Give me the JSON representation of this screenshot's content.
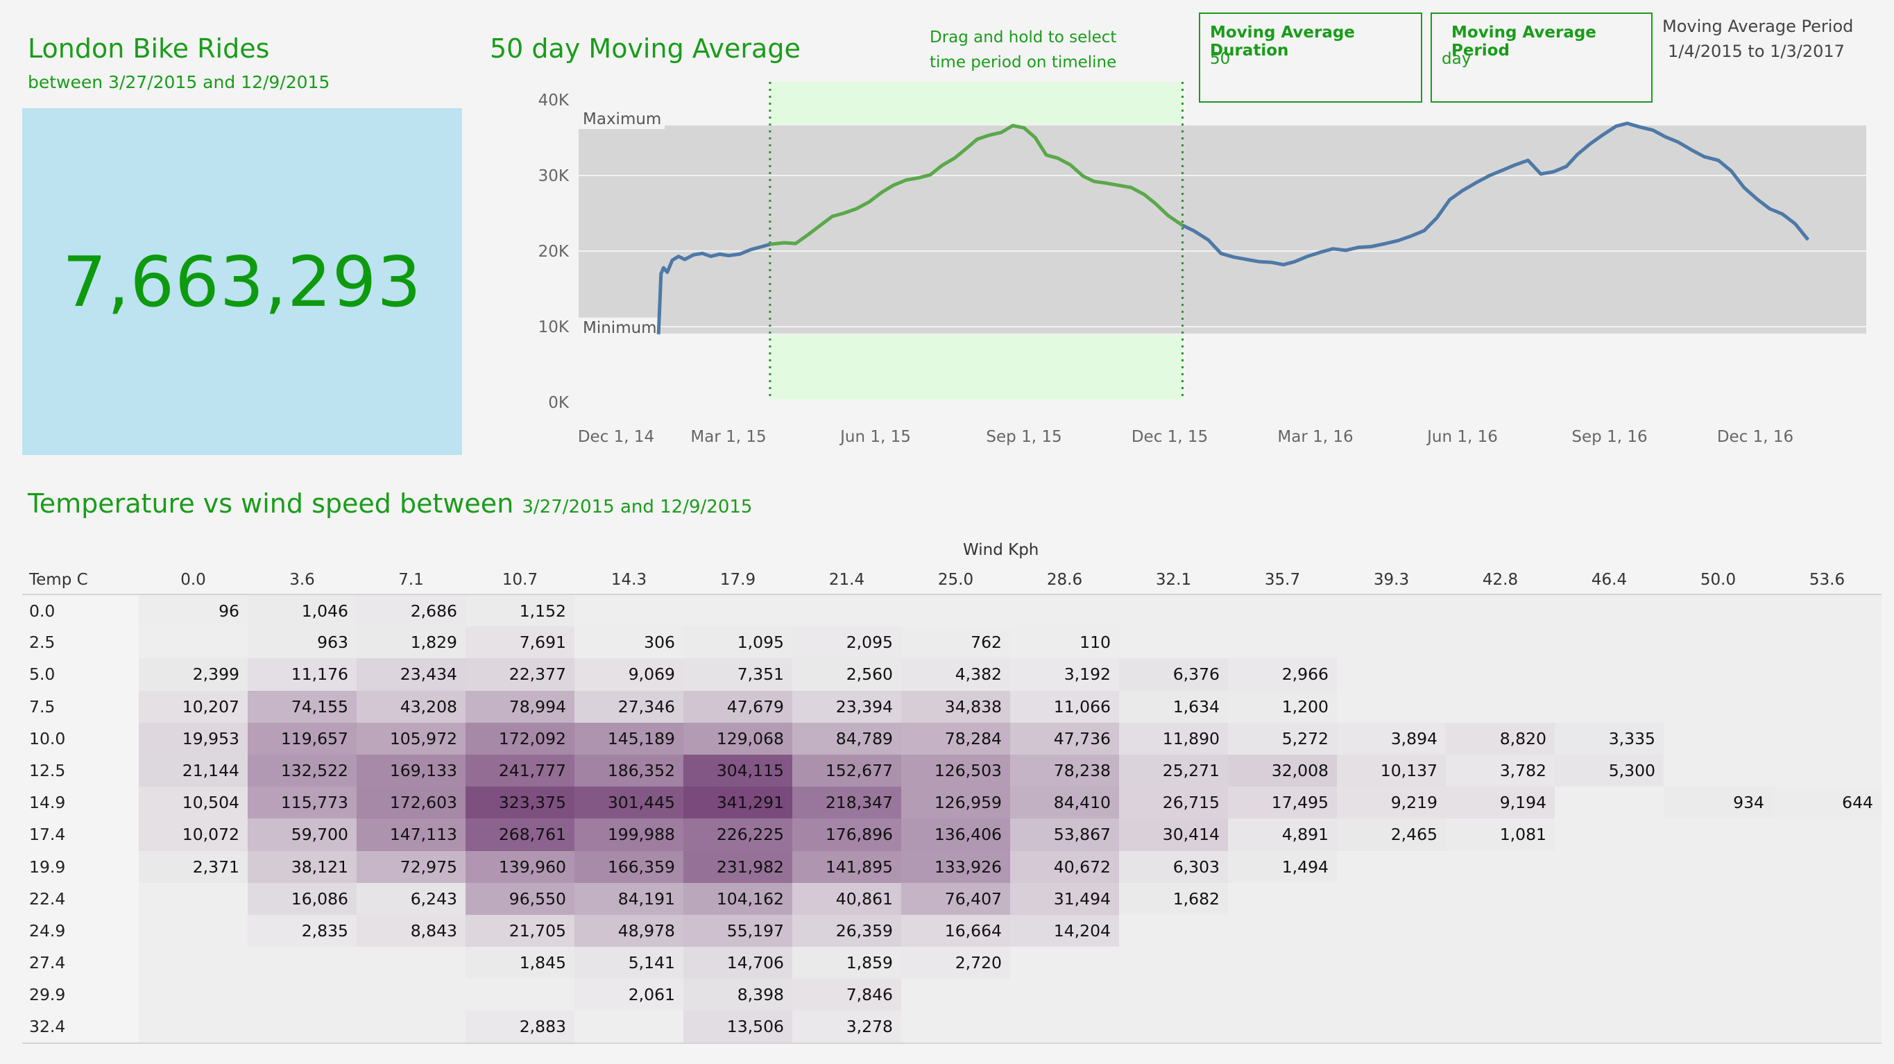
{
  "header": {
    "title": "London Bike Rides",
    "subtitle": "between 3/27/2015 and 12/9/2015",
    "total_rides": "7,663,293"
  },
  "moving_average": {
    "title": "50 day Moving Average",
    "drag_hint": "Drag and hold to select time period on timeline",
    "duration_label": "Moving Average Duration",
    "duration_value": "50",
    "period_label": "Moving Average Period",
    "period_value": "day",
    "info_label": "Moving Average Period",
    "info_value": "1/4/2015 to 1/3/2017"
  },
  "chart_data": {
    "type": "line",
    "title": "50 day Moving Average",
    "xlabel": "",
    "ylabel": "",
    "x_ticks": [
      "Dec 1, 14",
      "Mar 1, 15",
      "Jun 1, 15",
      "Sep 1, 15",
      "Dec 1, 15",
      "Mar 1, 16",
      "Jun 1, 16",
      "Sep 1, 16",
      "Dec 1, 16"
    ],
    "y_ticks": [
      "0K",
      "10K",
      "20K",
      "30K",
      "40K"
    ],
    "ylim": [
      0,
      40000
    ],
    "reference_band": {
      "min_label": "Minimum",
      "max_label": "Maximum",
      "min": 9000,
      "max": 36700
    },
    "highlight_range": [
      "2015-03-27",
      "2015-12-09"
    ],
    "series": [
      {
        "points": [
          [
            "2015-01-04",
            9000
          ],
          [
            "2015-01-06",
            17000
          ],
          [
            "2015-01-08",
            17800
          ],
          [
            "2015-01-11",
            17200
          ],
          [
            "2015-01-15",
            18800
          ],
          [
            "2015-01-20",
            19300
          ],
          [
            "2015-01-25",
            18900
          ],
          [
            "2015-02-01",
            19500
          ],
          [
            "2015-02-08",
            19700
          ],
          [
            "2015-02-15",
            19300
          ],
          [
            "2015-02-22",
            19600
          ],
          [
            "2015-03-01",
            19400
          ],
          [
            "2015-03-08",
            19600
          ],
          [
            "2015-03-15",
            20200
          ],
          [
            "2015-03-22",
            20600
          ],
          [
            "2015-03-27",
            20900
          ],
          [
            "2015-04-05",
            21100
          ],
          [
            "2015-04-12",
            21000
          ],
          [
            "2015-04-20",
            22200
          ],
          [
            "2015-04-28",
            23500
          ],
          [
            "2015-05-05",
            24600
          ],
          [
            "2015-05-12",
            25000
          ],
          [
            "2015-05-20",
            25600
          ],
          [
            "2015-05-28",
            26500
          ],
          [
            "2015-06-05",
            27800
          ],
          [
            "2015-06-12",
            28700
          ],
          [
            "2015-06-20",
            29400
          ],
          [
            "2015-06-28",
            29700
          ],
          [
            "2015-07-05",
            30100
          ],
          [
            "2015-07-12",
            31300
          ],
          [
            "2015-07-20",
            32300
          ],
          [
            "2015-07-28",
            33700
          ],
          [
            "2015-08-03",
            34800
          ],
          [
            "2015-08-10",
            35300
          ],
          [
            "2015-08-18",
            35700
          ],
          [
            "2015-08-25",
            36600
          ],
          [
            "2015-09-01",
            36300
          ],
          [
            "2015-09-08",
            35000
          ],
          [
            "2015-09-15",
            32700
          ],
          [
            "2015-09-22",
            32300
          ],
          [
            "2015-09-30",
            31400
          ],
          [
            "2015-10-08",
            29900
          ],
          [
            "2015-10-15",
            29200
          ],
          [
            "2015-10-22",
            29000
          ],
          [
            "2015-10-30",
            28700
          ],
          [
            "2015-11-07",
            28400
          ],
          [
            "2015-11-15",
            27500
          ],
          [
            "2015-11-22",
            26300
          ],
          [
            "2015-11-30",
            24700
          ],
          [
            "2015-12-09",
            23400
          ],
          [
            "2015-12-16",
            22700
          ],
          [
            "2015-12-25",
            21500
          ],
          [
            "2016-01-02",
            19700
          ],
          [
            "2016-01-10",
            19200
          ],
          [
            "2016-01-18",
            18900
          ],
          [
            "2016-01-26",
            18600
          ],
          [
            "2016-02-03",
            18500
          ],
          [
            "2016-02-10",
            18200
          ],
          [
            "2016-02-17",
            18600
          ],
          [
            "2016-02-25",
            19300
          ],
          [
            "2016-03-05",
            19900
          ],
          [
            "2016-03-12",
            20300
          ],
          [
            "2016-03-20",
            20100
          ],
          [
            "2016-03-28",
            20500
          ],
          [
            "2016-04-05",
            20600
          ],
          [
            "2016-04-14",
            21000
          ],
          [
            "2016-04-22",
            21400
          ],
          [
            "2016-04-30",
            22000
          ],
          [
            "2016-05-08",
            22700
          ],
          [
            "2016-05-16",
            24400
          ],
          [
            "2016-05-24",
            26800
          ],
          [
            "2016-06-01",
            28000
          ],
          [
            "2016-06-10",
            29100
          ],
          [
            "2016-06-18",
            30000
          ],
          [
            "2016-06-26",
            30700
          ],
          [
            "2016-07-04",
            31400
          ],
          [
            "2016-07-12",
            32000
          ],
          [
            "2016-07-20",
            30200
          ],
          [
            "2016-07-28",
            30500
          ],
          [
            "2016-08-05",
            31200
          ],
          [
            "2016-08-12",
            32800
          ],
          [
            "2016-08-20",
            34200
          ],
          [
            "2016-08-28",
            35400
          ],
          [
            "2016-09-05",
            36500
          ],
          [
            "2016-09-12",
            36900
          ],
          [
            "2016-09-20",
            36400
          ],
          [
            "2016-09-28",
            36000
          ],
          [
            "2016-10-06",
            35100
          ],
          [
            "2016-10-14",
            34400
          ],
          [
            "2016-10-22",
            33400
          ],
          [
            "2016-10-30",
            32500
          ],
          [
            "2016-11-08",
            32000
          ],
          [
            "2016-11-16",
            30600
          ],
          [
            "2016-11-24",
            28400
          ],
          [
            "2016-12-02",
            26900
          ],
          [
            "2016-12-10",
            25600
          ],
          [
            "2016-12-18",
            24900
          ],
          [
            "2016-12-26",
            23600
          ],
          [
            "2017-01-03",
            21500
          ]
        ]
      }
    ]
  },
  "heatmap": {
    "title": "Temperature vs wind speed between",
    "title_range": "3/27/2015 and 12/9/2015",
    "column_axis_label": "Wind Kph",
    "row_axis_label": "Temp C",
    "columns": [
      "0.0",
      "3.6",
      "7.1",
      "10.7",
      "14.3",
      "17.9",
      "21.4",
      "25.0",
      "28.6",
      "32.1",
      "35.7",
      "39.3",
      "42.8",
      "46.4",
      "50.0",
      "53.6"
    ],
    "rows": [
      {
        "label": "0.0",
        "values": [
          "96",
          "1,046",
          "2,686",
          "1,152",
          "",
          "",
          "",
          "",
          "",
          "",
          "",
          "",
          "",
          "",
          "",
          ""
        ]
      },
      {
        "label": "2.5",
        "values": [
          "",
          "963",
          "1,829",
          "7,691",
          "306",
          "1,095",
          "2,095",
          "762",
          "110",
          "",
          "",
          "",
          "",
          "",
          "",
          ""
        ]
      },
      {
        "label": "5.0",
        "values": [
          "2,399",
          "11,176",
          "23,434",
          "22,377",
          "9,069",
          "7,351",
          "2,560",
          "4,382",
          "3,192",
          "6,376",
          "2,966",
          "",
          "",
          "",
          "",
          ""
        ]
      },
      {
        "label": "7.5",
        "values": [
          "10,207",
          "74,155",
          "43,208",
          "78,994",
          "27,346",
          "47,679",
          "23,394",
          "34,838",
          "11,066",
          "1,634",
          "1,200",
          "",
          "",
          "",
          "",
          ""
        ]
      },
      {
        "label": "10.0",
        "values": [
          "19,953",
          "119,657",
          "105,972",
          "172,092",
          "145,189",
          "129,068",
          "84,789",
          "78,284",
          "47,736",
          "11,890",
          "5,272",
          "3,894",
          "8,820",
          "3,335",
          "",
          ""
        ]
      },
      {
        "label": "12.5",
        "values": [
          "21,144",
          "132,522",
          "169,133",
          "241,777",
          "186,352",
          "304,115",
          "152,677",
          "126,503",
          "78,238",
          "25,271",
          "32,008",
          "10,137",
          "3,782",
          "5,300",
          "",
          ""
        ]
      },
      {
        "label": "14.9",
        "values": [
          "10,504",
          "115,773",
          "172,603",
          "323,375",
          "301,445",
          "341,291",
          "218,347",
          "126,959",
          "84,410",
          "26,715",
          "17,495",
          "9,219",
          "9,194",
          "",
          "934",
          "644"
        ]
      },
      {
        "label": "17.4",
        "values": [
          "10,072",
          "59,700",
          "147,113",
          "268,761",
          "199,988",
          "226,225",
          "176,896",
          "136,406",
          "53,867",
          "30,414",
          "4,891",
          "2,465",
          "1,081",
          "",
          "",
          ""
        ]
      },
      {
        "label": "19.9",
        "values": [
          "2,371",
          "38,121",
          "72,975",
          "139,960",
          "166,359",
          "231,982",
          "141,895",
          "133,926",
          "40,672",
          "6,303",
          "1,494",
          "",
          "",
          "",
          "",
          ""
        ]
      },
      {
        "label": "22.4",
        "values": [
          "",
          "16,086",
          "6,243",
          "96,550",
          "84,191",
          "104,162",
          "40,861",
          "76,407",
          "31,494",
          "1,682",
          "",
          "",
          "",
          "",
          "",
          ""
        ]
      },
      {
        "label": "24.9",
        "values": [
          "",
          "2,835",
          "8,843",
          "21,705",
          "48,978",
          "55,197",
          "26,359",
          "16,664",
          "14,204",
          "",
          "",
          "",
          "",
          "",
          "",
          ""
        ]
      },
      {
        "label": "27.4",
        "values": [
          "",
          "",
          "",
          "1,845",
          "5,141",
          "14,706",
          "1,859",
          "2,720",
          "",
          "",
          "",
          "",
          "",
          "",
          "",
          ""
        ]
      },
      {
        "label": "29.9",
        "values": [
          "",
          "",
          "",
          "",
          "2,061",
          "8,398",
          "7,846",
          "",
          "",
          "",
          "",
          "",
          "",
          "",
          "",
          ""
        ]
      },
      {
        "label": "32.4",
        "values": [
          "",
          "",
          "",
          "2,883",
          "",
          "13,506",
          "3,278",
          "",
          "",
          "",
          "",
          "",
          "",
          "",
          "",
          ""
        ]
      }
    ]
  },
  "colors": {
    "accent_green": "#1a9c1a",
    "kpi_background": "#bde2f0",
    "line_blue": "#4e79a7",
    "line_green": "#5aa84a",
    "highlight_band": "#e2fbe0",
    "heat_max": "#7a4a7c"
  }
}
